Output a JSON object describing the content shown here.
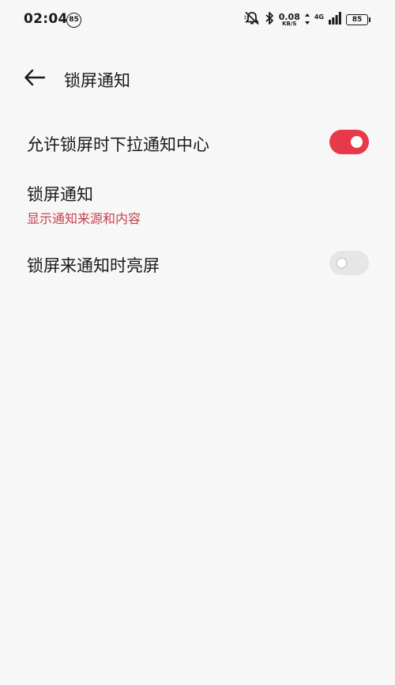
{
  "status_bar": {
    "time": "02:04",
    "notification_badge": "85",
    "net_speed_value": "0.08",
    "net_speed_unit": "KB/S",
    "network_type": "4G",
    "battery": "85",
    "icons": [
      "mute-icon",
      "bluetooth-icon",
      "data-arrows-icon",
      "signal-icon",
      "battery-icon"
    ]
  },
  "header": {
    "back_icon": "arrow-left-icon",
    "title": "锁屏通知"
  },
  "settings": [
    {
      "title": "允许锁屏时下拉通知中心",
      "toggle": true
    },
    {
      "title": "锁屏通知",
      "subtitle": "显示通知来源和内容"
    },
    {
      "title": "锁屏来通知时亮屏",
      "toggle": false
    }
  ],
  "colors": {
    "accent": "#e8394a",
    "subtitle": "#c5414f",
    "background": "#f7f7f7",
    "toggle_off": "#e6e6e6"
  }
}
